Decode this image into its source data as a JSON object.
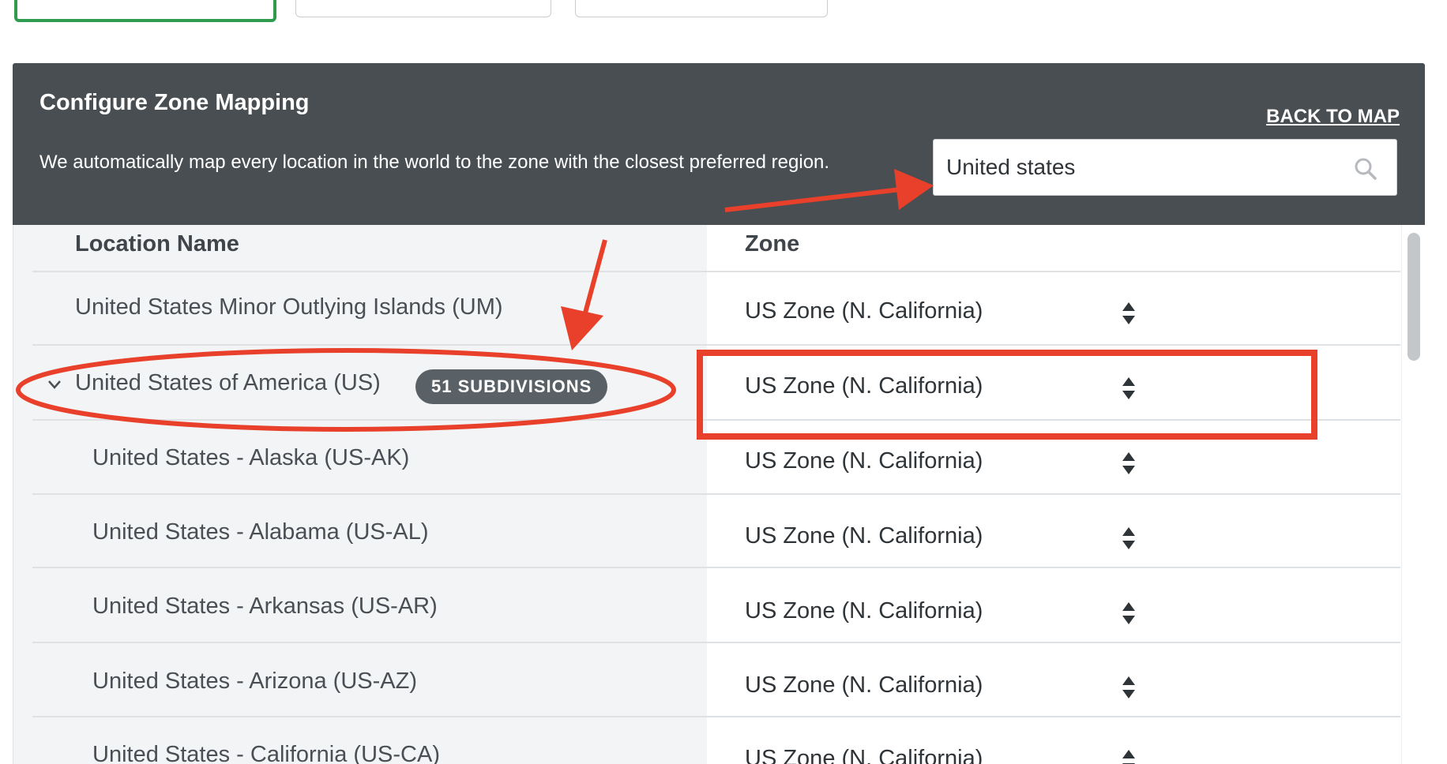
{
  "header": {
    "title": "Configure Zone Mapping",
    "description": "We automatically map every location in the world to the zone with the closest preferred region.",
    "back_link": "BACK TO MAP"
  },
  "search": {
    "value": "United states",
    "icon": "search-icon"
  },
  "table": {
    "columns": {
      "location": "Location Name",
      "zone": "Zone"
    },
    "rows": [
      {
        "location": "United States Minor Outlying Islands (UM)",
        "zone": "US Zone (N. California)"
      },
      {
        "location": "United States of America (US)",
        "zone": "US Zone (N. California)",
        "badge": "51 SUBDIVISIONS",
        "expanded": true
      },
      {
        "location": "United States - Alaska (US-AK)",
        "zone": "US Zone (N. California)"
      },
      {
        "location": "United States - Alabama (US-AL)",
        "zone": "US Zone (N. California)"
      },
      {
        "location": "United States - Arkansas (US-AR)",
        "zone": "US Zone (N. California)"
      },
      {
        "location": "United States - Arizona (US-AZ)",
        "zone": "US Zone (N. California)"
      },
      {
        "location": "United States - California (US-CA)",
        "zone": "US Zone (N. California)"
      }
    ]
  },
  "colors": {
    "header_bg": "#484e52",
    "active_tab_border": "#2e9b4f",
    "annotation_red": "#e8402a",
    "badge_bg": "#5a6166"
  }
}
